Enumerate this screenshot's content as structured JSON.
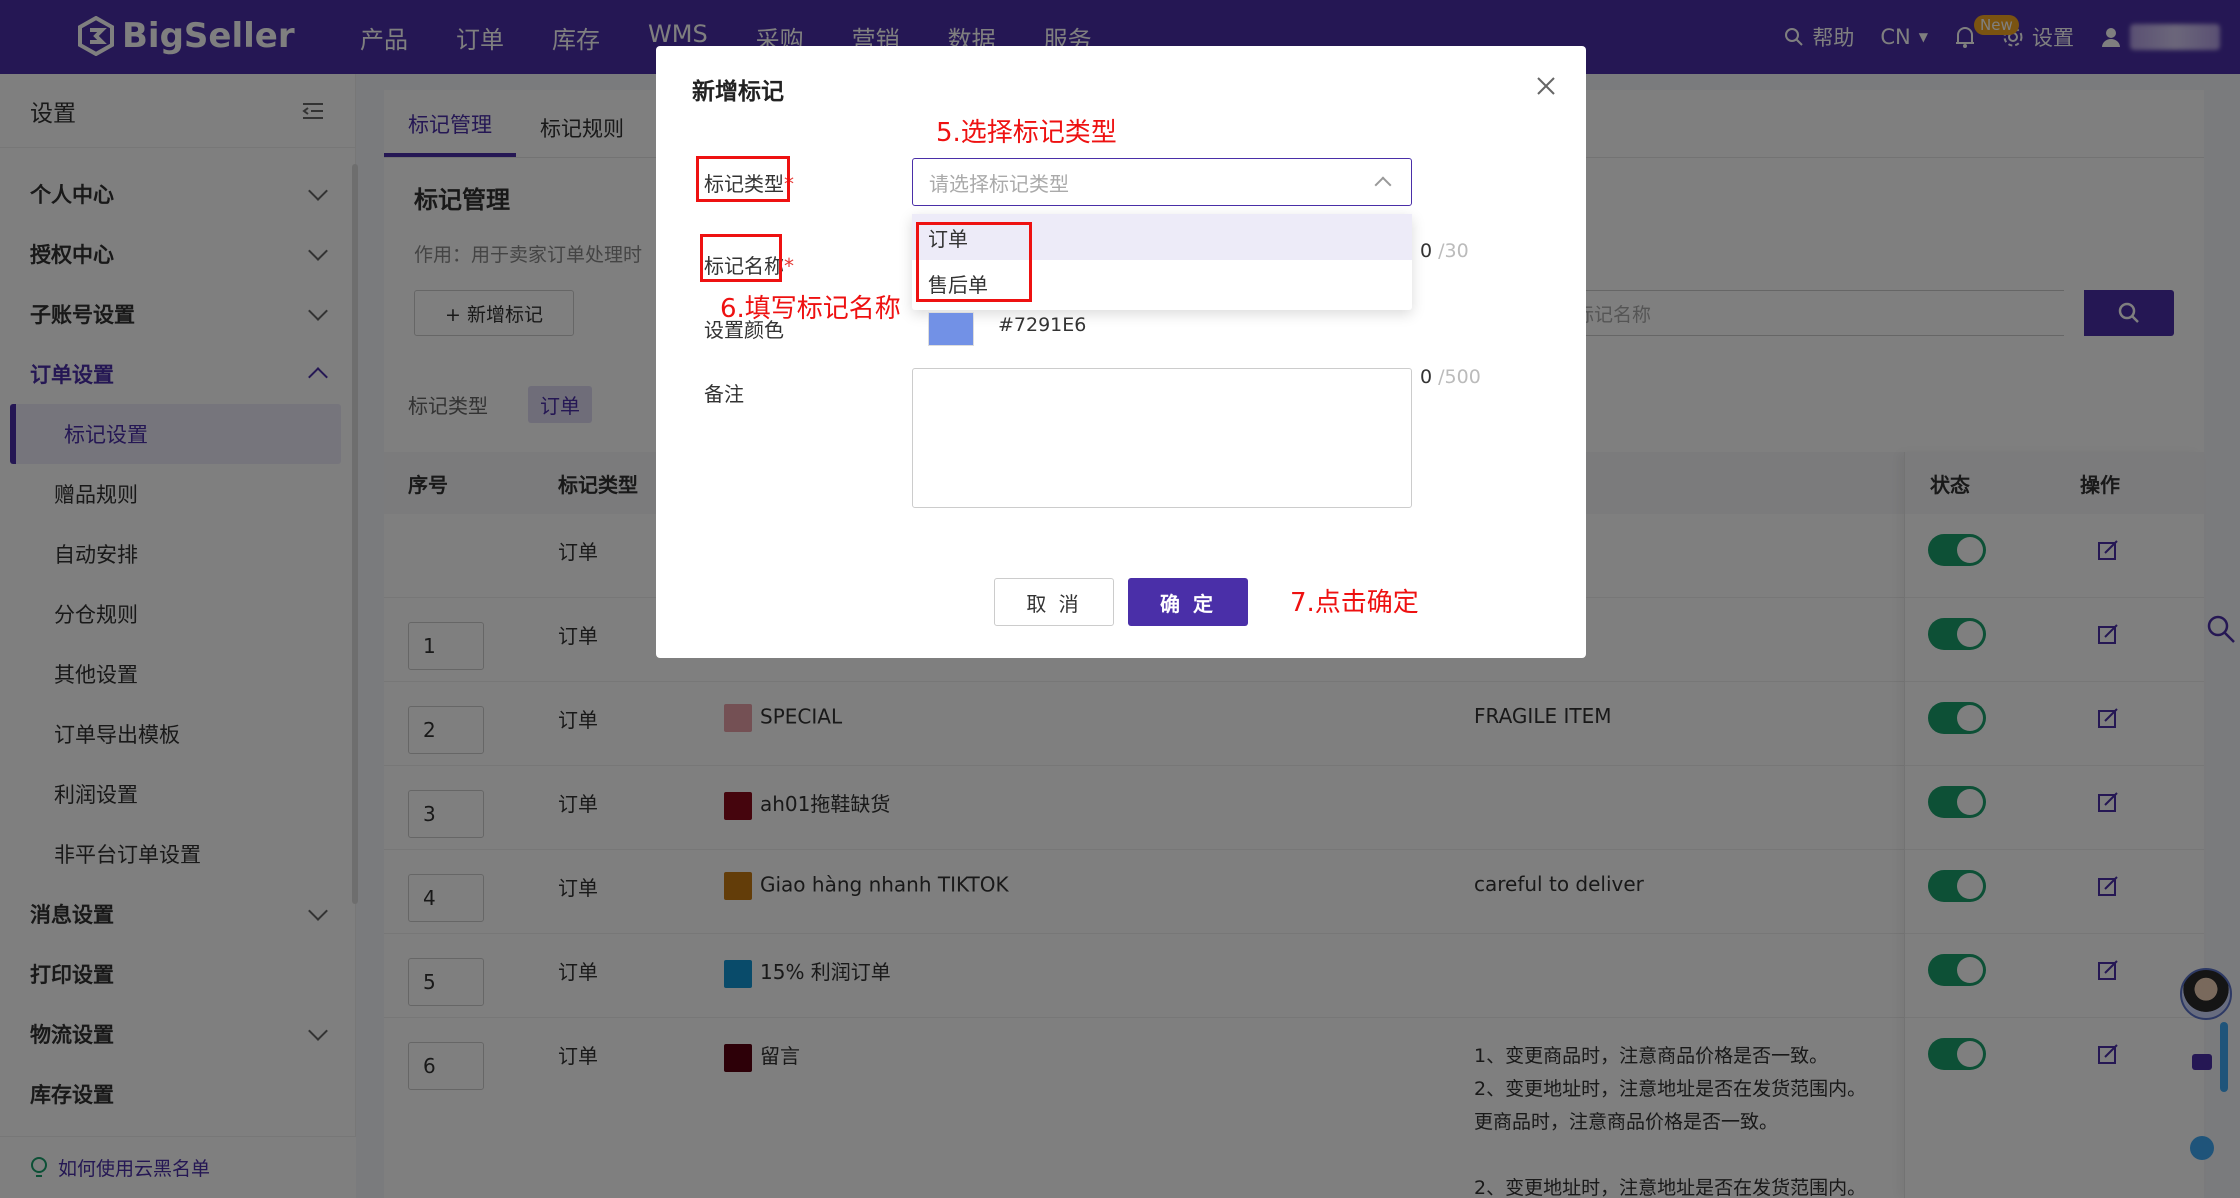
{
  "brand": "BigSeller",
  "nav": [
    "产品",
    "订单",
    "库存",
    "WMS",
    "采购",
    "营销",
    "数据",
    "服务"
  ],
  "top_right": {
    "help": "帮助",
    "lang": "CN",
    "new_badge": "New",
    "settings": "设置"
  },
  "sidebar": {
    "title": "设置",
    "items": [
      {
        "label": "个人中心"
      },
      {
        "label": "授权中心"
      },
      {
        "label": "子账号设置"
      },
      {
        "label": "订单设置"
      },
      {
        "label": "消息设置"
      },
      {
        "label": "打印设置"
      },
      {
        "label": "物流设置"
      },
      {
        "label": "库存设置"
      }
    ],
    "sub_items": [
      "标记设置",
      "赠品规则",
      "自动安排",
      "分仓规则",
      "其他设置",
      "订单导出模板",
      "利润设置",
      "非平台订单设置"
    ],
    "bottom_link": "如何使用云黑名单"
  },
  "main": {
    "tabs": [
      "标记管理",
      "标记规则"
    ],
    "section_title": "标记管理",
    "section_desc": "作用：用于卖家订单处理时",
    "add_button": "+ 新增标记",
    "search_placeholder": "标记名称",
    "filter_label": "标记类型",
    "filter_chip": "订单",
    "table": {
      "headers": {
        "seq": "序号",
        "type": "标记类型",
        "status": "状态",
        "action": "操作"
      },
      "rows": [
        {
          "seq": "",
          "type": "订单",
          "name": "",
          "color": "",
          "remark": ""
        },
        {
          "seq": "1",
          "type": "订单",
          "name": "",
          "color": "",
          "remark": ""
        },
        {
          "seq": "2",
          "type": "订单",
          "name": "SPECIAL",
          "color": "#e8a0a8",
          "remark": "FRAGILE ITEM"
        },
        {
          "seq": "3",
          "type": "订单",
          "name": "ah01拖鞋缺货",
          "color": "#8b0a1a",
          "remark": ""
        },
        {
          "seq": "4",
          "type": "订单",
          "name": "Giao hàng nhanh TIKTOK",
          "color": "#c77a12",
          "remark": "careful to deliver"
        },
        {
          "seq": "5",
          "type": "订单",
          "name": "15% 利润订单",
          "color": "#1296d4",
          "remark": ""
        },
        {
          "seq": "6",
          "type": "订单",
          "name": "留言",
          "color": "#5a0010",
          "remark_lines": [
            "1、变更商品时，注意商品价格是否一致。",
            "2、变更地址时，注意地址是否在发货范围内。",
            "更商品时，注意商品价格是否一致。",
            "",
            "2、变更地址时，注意地址是否在发货范围内。"
          ]
        }
      ]
    }
  },
  "modal": {
    "title": "新增标记",
    "type_label": "标记类型",
    "name_label": "标记名称",
    "color_label": "设置颜色",
    "remark_label": "备注",
    "required_mark": "*",
    "select_placeholder": "请选择标记类型",
    "options": [
      "订单",
      "售后单"
    ],
    "name_count": "0",
    "name_max": "/30",
    "color_value": "#7291E6",
    "remark_count": "0",
    "remark_max": "/500",
    "cancel": "取 消",
    "ok": "确 定"
  },
  "annotations": {
    "step5": "5.选择标记类型",
    "step6": "6.填写标记名称",
    "step7": "7.点击确定"
  },
  "colors": {
    "brand": "#4a2fa8",
    "toggle_on": "#1aa06d",
    "annotation": "#e11111"
  }
}
